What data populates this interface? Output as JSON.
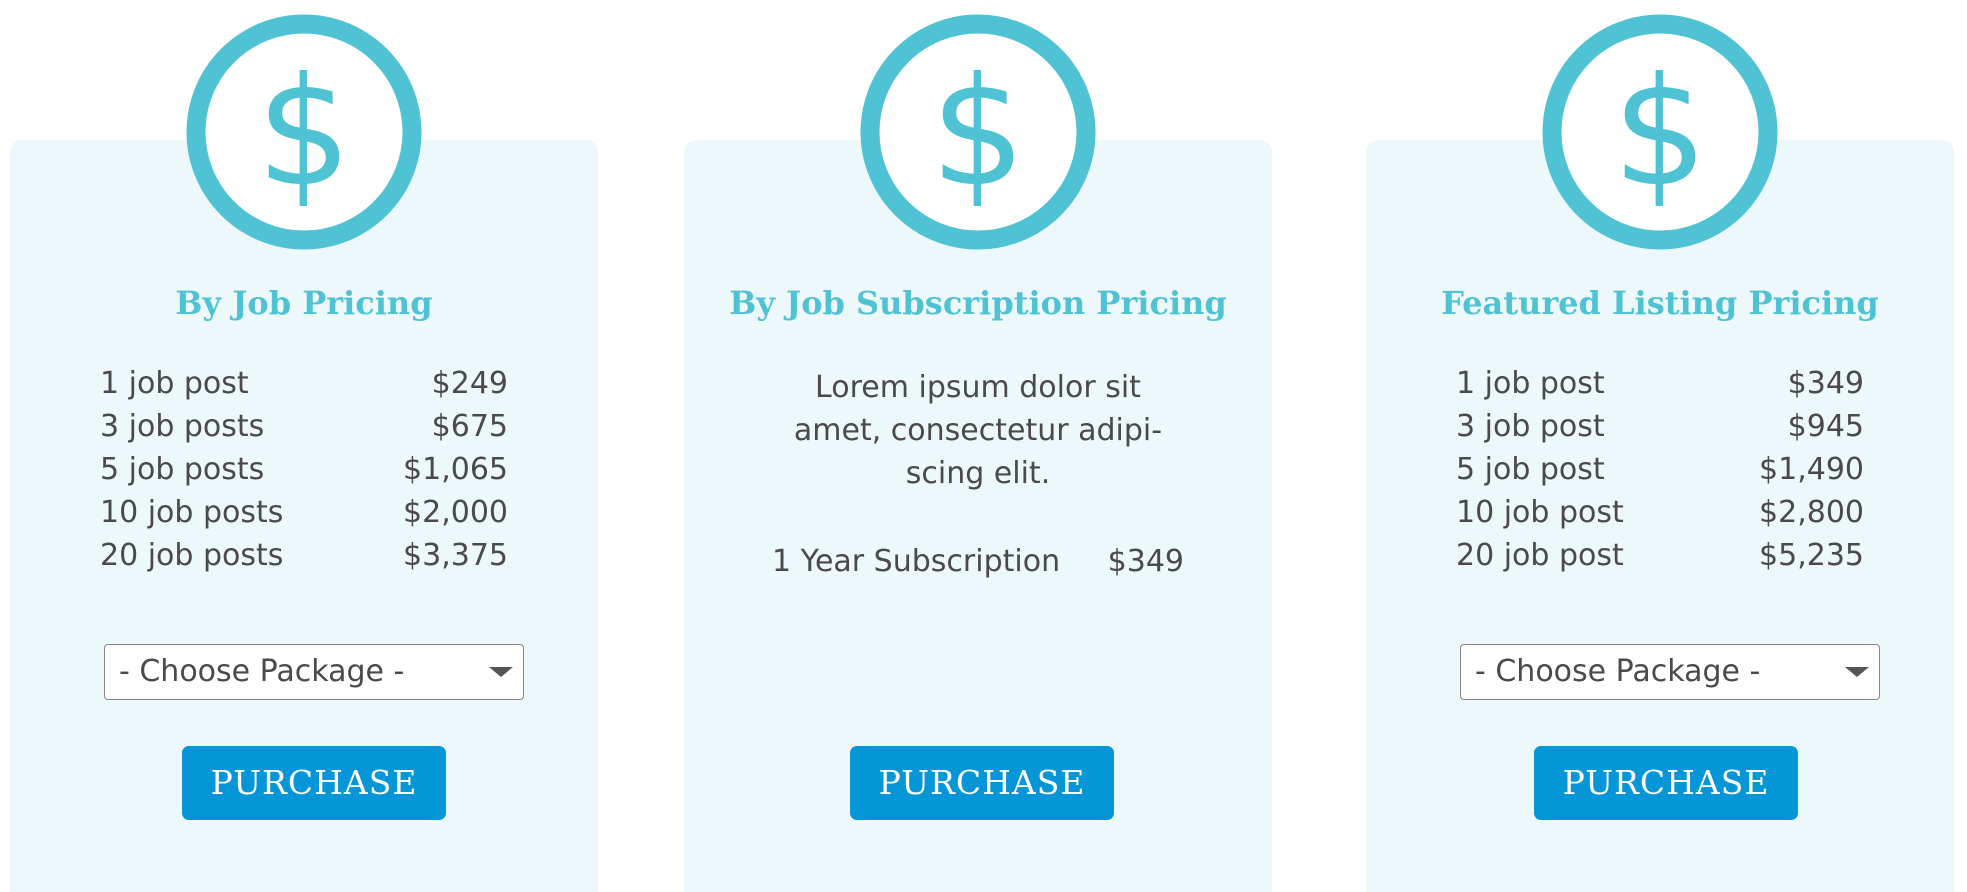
{
  "colors": {
    "accent": "#4fc3d3",
    "card_bg": "#edf8fa",
    "button": "#0496d6"
  },
  "cards": [
    {
      "icon": "dollar-circle-icon",
      "title": "By Job Pricing",
      "prices": [
        {
          "label": "1 job post",
          "price": "$249"
        },
        {
          "label": "3 job posts",
          "price": "$675"
        },
        {
          "label": "5 job posts",
          "price": "$1,065"
        },
        {
          "label": "10 job posts",
          "price": "$2,000"
        },
        {
          "label": "20 job posts",
          "price": "$3,375"
        }
      ],
      "select_value": "- Choose Package -",
      "button_label": "PURCHASE"
    },
    {
      "icon": "dollar-circle-icon",
      "title": "By Job Subscription Pricing",
      "description_lines": [
        "Lorem ipsum dolor sit",
        "amet, consectetur adipi-",
        "scing elit."
      ],
      "subscription": {
        "label": "1 Year Subscription",
        "price": "$349"
      },
      "button_label": "PURCHASE"
    },
    {
      "icon": "dollar-circle-icon",
      "title": "Featured Listing Pricing",
      "prices": [
        {
          "label": "1 job post",
          "price": "$349"
        },
        {
          "label": "3 job post",
          "price": "$945"
        },
        {
          "label": "5 job post",
          "price": "$1,490"
        },
        {
          "label": "10 job post",
          "price": "$2,800"
        },
        {
          "label": "20 job post",
          "price": "$5,235"
        }
      ],
      "select_value": "- Choose Package -",
      "button_label": "PURCHASE"
    }
  ]
}
